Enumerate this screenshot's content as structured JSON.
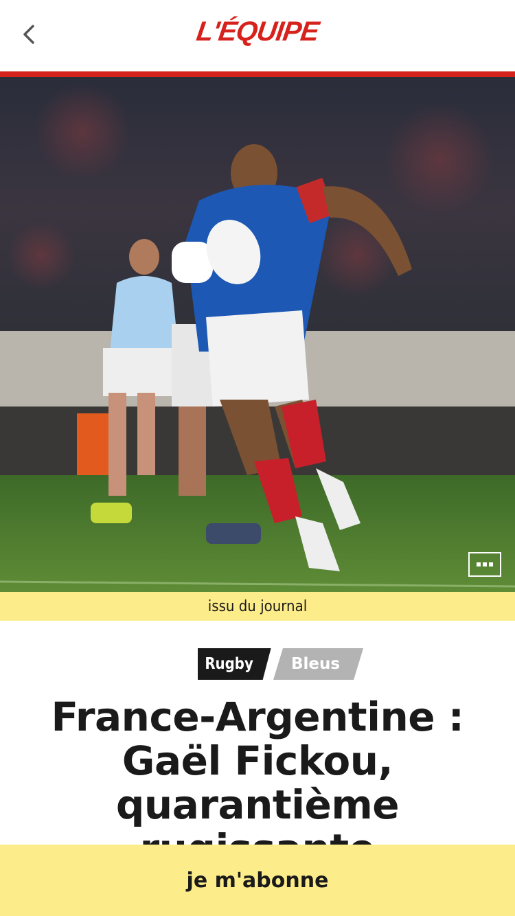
{
  "header": {
    "logo_text": "L'ÉQUIPE",
    "back_icon": "chevron-left-icon",
    "brand_color": "#d6221c"
  },
  "hero": {
    "image_subject": "rugby player in blue France jersey carrying ball",
    "more_icon": "ellipsis-icon"
  },
  "source_label": "issu du journal",
  "tags": {
    "sport": "Rugby",
    "team": "Bleus"
  },
  "article": {
    "headline": "France-Argentine : Gaël Fickou, quarantième rugissante"
  },
  "cta": {
    "subscribe_label": "je m'abonne",
    "accent": "#fdec8a"
  }
}
